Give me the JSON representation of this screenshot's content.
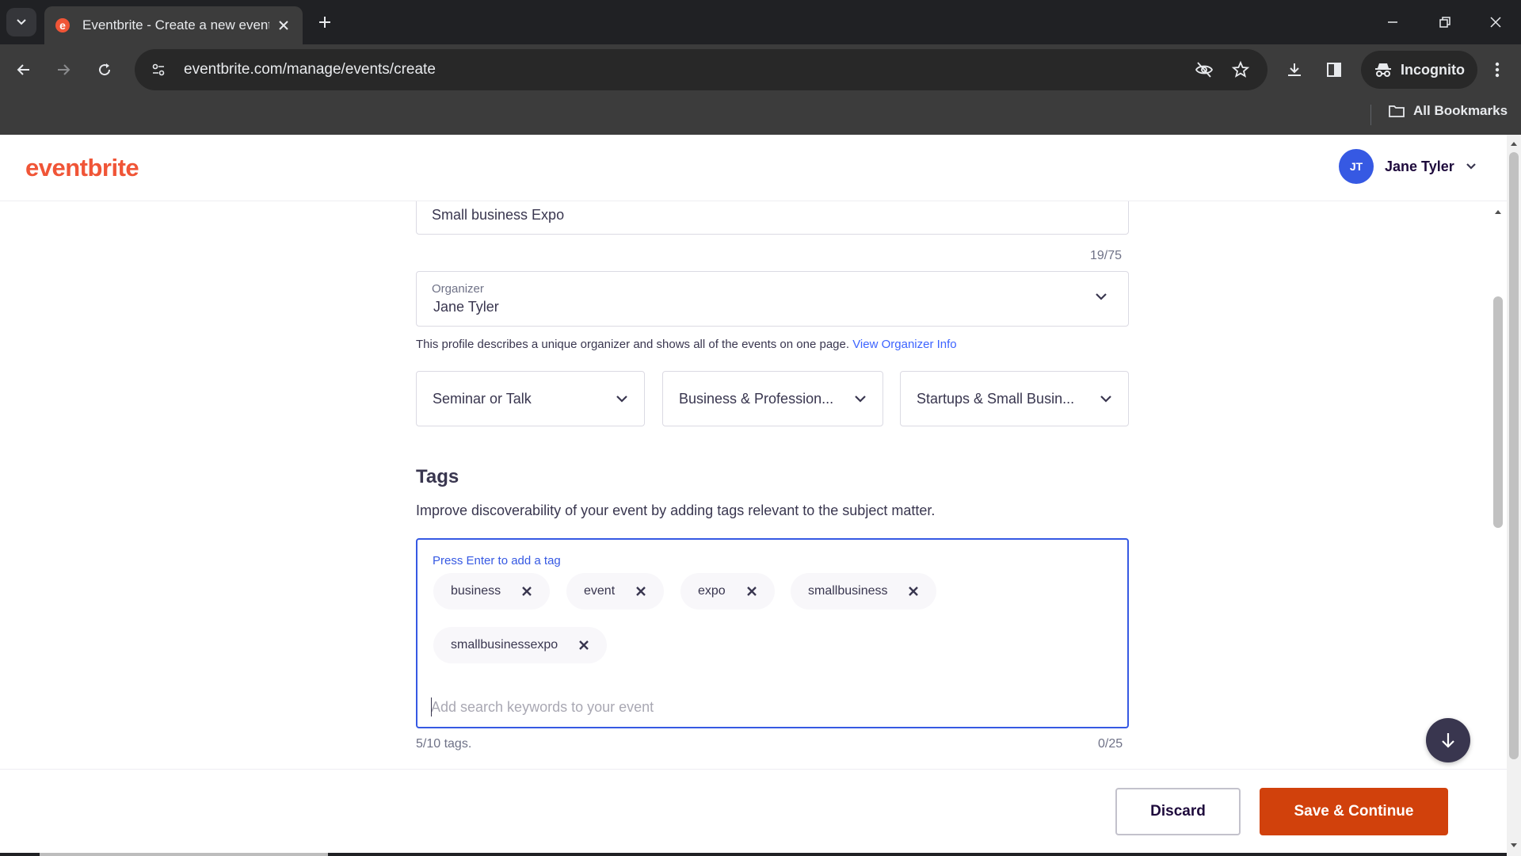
{
  "browser": {
    "tab_title": "Eventbrite - Create a new event",
    "url": "eventbrite.com/manage/events/create",
    "incognito_label": "Incognito",
    "all_bookmarks_label": "All Bookmarks",
    "colors": {
      "tabstrip": "#202124",
      "toolbar": "#3c3c3c",
      "text": "#e8eaed"
    }
  },
  "header": {
    "logo_text": "eventbrite",
    "user_initials": "JT",
    "user_name": "Jane Tyler",
    "colors": {
      "logo": "#f05537",
      "avatar": "#3659e3"
    }
  },
  "form": {
    "title_value": "Small business Expo",
    "title_counter": "19/75",
    "organizer": {
      "label": "Organizer",
      "value": "Jane Tyler"
    },
    "organizer_helper": "This profile describes a unique organizer and shows all of the events on one page.",
    "organizer_link": "View Organizer Info",
    "selects": [
      {
        "value": "Seminar or Talk"
      },
      {
        "value": "Business & Profession..."
      },
      {
        "value": "Startups & Small Busin..."
      }
    ],
    "tags": {
      "heading": "Tags",
      "description": "Improve discoverability of your event by adding tags relevant to the subject matter.",
      "hint": "Press Enter to add a tag",
      "chips": [
        "business",
        "event",
        "expo",
        "smallbusiness",
        "smallbusinessexpo"
      ],
      "input_placeholder": "Add search keywords to your event",
      "tag_count": "5/10 tags.",
      "char_count": "0/25",
      "colors": {
        "focus_border": "#3659e3",
        "chip_bg": "#f8f7fa"
      }
    }
  },
  "footer": {
    "discard_label": "Discard",
    "save_label": "Save & Continue",
    "colors": {
      "save_bg": "#d1410c"
    }
  },
  "icons": [
    "tab-list-icon",
    "eventbrite-favicon-icon",
    "close-icon",
    "plus-icon",
    "minimize-icon",
    "restore-icon",
    "window-close-icon",
    "back-icon",
    "forward-icon",
    "reload-icon",
    "site-info-icon",
    "eye-off-icon",
    "star-icon",
    "download-icon",
    "sidepanel-icon",
    "incognito-icon",
    "kebab-menu-icon",
    "folder-icon",
    "chevron-down-icon",
    "remove-tag-icon",
    "arrow-down-icon"
  ]
}
